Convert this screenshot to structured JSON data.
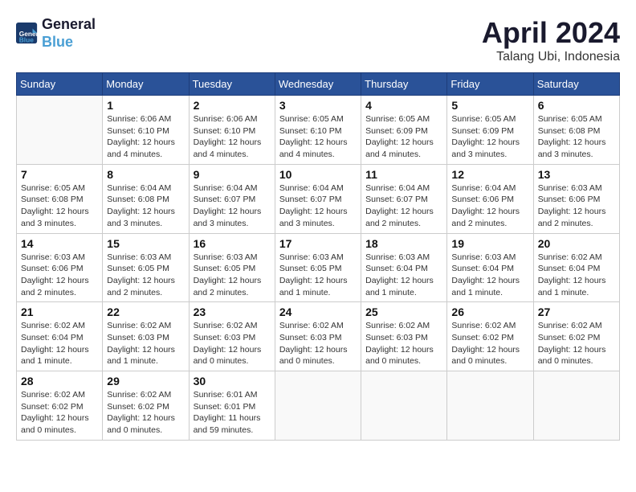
{
  "header": {
    "logo_line1": "General",
    "logo_line2": "Blue",
    "main_title": "April 2024",
    "subtitle": "Talang Ubi, Indonesia"
  },
  "calendar": {
    "days_of_week": [
      "Sunday",
      "Monday",
      "Tuesday",
      "Wednesday",
      "Thursday",
      "Friday",
      "Saturday"
    ],
    "weeks": [
      [
        {
          "day": "",
          "info": ""
        },
        {
          "day": "1",
          "info": "Sunrise: 6:06 AM\nSunset: 6:10 PM\nDaylight: 12 hours\nand 4 minutes."
        },
        {
          "day": "2",
          "info": "Sunrise: 6:06 AM\nSunset: 6:10 PM\nDaylight: 12 hours\nand 4 minutes."
        },
        {
          "day": "3",
          "info": "Sunrise: 6:05 AM\nSunset: 6:10 PM\nDaylight: 12 hours\nand 4 minutes."
        },
        {
          "day": "4",
          "info": "Sunrise: 6:05 AM\nSunset: 6:09 PM\nDaylight: 12 hours\nand 4 minutes."
        },
        {
          "day": "5",
          "info": "Sunrise: 6:05 AM\nSunset: 6:09 PM\nDaylight: 12 hours\nand 3 minutes."
        },
        {
          "day": "6",
          "info": "Sunrise: 6:05 AM\nSunset: 6:08 PM\nDaylight: 12 hours\nand 3 minutes."
        }
      ],
      [
        {
          "day": "7",
          "info": "Sunrise: 6:05 AM\nSunset: 6:08 PM\nDaylight: 12 hours\nand 3 minutes."
        },
        {
          "day": "8",
          "info": "Sunrise: 6:04 AM\nSunset: 6:08 PM\nDaylight: 12 hours\nand 3 minutes."
        },
        {
          "day": "9",
          "info": "Sunrise: 6:04 AM\nSunset: 6:07 PM\nDaylight: 12 hours\nand 3 minutes."
        },
        {
          "day": "10",
          "info": "Sunrise: 6:04 AM\nSunset: 6:07 PM\nDaylight: 12 hours\nand 3 minutes."
        },
        {
          "day": "11",
          "info": "Sunrise: 6:04 AM\nSunset: 6:07 PM\nDaylight: 12 hours\nand 2 minutes."
        },
        {
          "day": "12",
          "info": "Sunrise: 6:04 AM\nSunset: 6:06 PM\nDaylight: 12 hours\nand 2 minutes."
        },
        {
          "day": "13",
          "info": "Sunrise: 6:03 AM\nSunset: 6:06 PM\nDaylight: 12 hours\nand 2 minutes."
        }
      ],
      [
        {
          "day": "14",
          "info": "Sunrise: 6:03 AM\nSunset: 6:06 PM\nDaylight: 12 hours\nand 2 minutes."
        },
        {
          "day": "15",
          "info": "Sunrise: 6:03 AM\nSunset: 6:05 PM\nDaylight: 12 hours\nand 2 minutes."
        },
        {
          "day": "16",
          "info": "Sunrise: 6:03 AM\nSunset: 6:05 PM\nDaylight: 12 hours\nand 2 minutes."
        },
        {
          "day": "17",
          "info": "Sunrise: 6:03 AM\nSunset: 6:05 PM\nDaylight: 12 hours\nand 1 minute."
        },
        {
          "day": "18",
          "info": "Sunrise: 6:03 AM\nSunset: 6:04 PM\nDaylight: 12 hours\nand 1 minute."
        },
        {
          "day": "19",
          "info": "Sunrise: 6:03 AM\nSunset: 6:04 PM\nDaylight: 12 hours\nand 1 minute."
        },
        {
          "day": "20",
          "info": "Sunrise: 6:02 AM\nSunset: 6:04 PM\nDaylight: 12 hours\nand 1 minute."
        }
      ],
      [
        {
          "day": "21",
          "info": "Sunrise: 6:02 AM\nSunset: 6:04 PM\nDaylight: 12 hours\nand 1 minute."
        },
        {
          "day": "22",
          "info": "Sunrise: 6:02 AM\nSunset: 6:03 PM\nDaylight: 12 hours\nand 1 minute."
        },
        {
          "day": "23",
          "info": "Sunrise: 6:02 AM\nSunset: 6:03 PM\nDaylight: 12 hours\nand 0 minutes."
        },
        {
          "day": "24",
          "info": "Sunrise: 6:02 AM\nSunset: 6:03 PM\nDaylight: 12 hours\nand 0 minutes."
        },
        {
          "day": "25",
          "info": "Sunrise: 6:02 AM\nSunset: 6:03 PM\nDaylight: 12 hours\nand 0 minutes."
        },
        {
          "day": "26",
          "info": "Sunrise: 6:02 AM\nSunset: 6:02 PM\nDaylight: 12 hours\nand 0 minutes."
        },
        {
          "day": "27",
          "info": "Sunrise: 6:02 AM\nSunset: 6:02 PM\nDaylight: 12 hours\nand 0 minutes."
        }
      ],
      [
        {
          "day": "28",
          "info": "Sunrise: 6:02 AM\nSunset: 6:02 PM\nDaylight: 12 hours\nand 0 minutes."
        },
        {
          "day": "29",
          "info": "Sunrise: 6:02 AM\nSunset: 6:02 PM\nDaylight: 12 hours\nand 0 minutes."
        },
        {
          "day": "30",
          "info": "Sunrise: 6:01 AM\nSunset: 6:01 PM\nDaylight: 11 hours\nand 59 minutes."
        },
        {
          "day": "",
          "info": ""
        },
        {
          "day": "",
          "info": ""
        },
        {
          "day": "",
          "info": ""
        },
        {
          "day": "",
          "info": ""
        }
      ]
    ]
  }
}
